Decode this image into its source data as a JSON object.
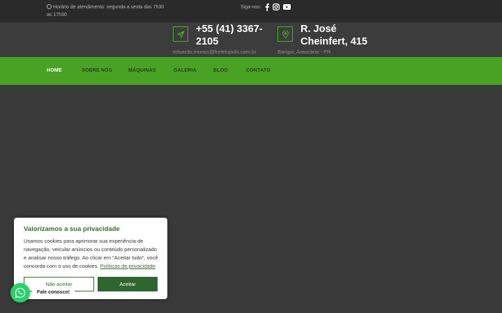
{
  "topbar": {
    "hours_text": "Horário de atendimento: segunda a sexta das 7h30 as 17h30",
    "social_label": "Siga-nos:",
    "social_icons": [
      "facebook-icon",
      "instagram-icon",
      "youtube-icon"
    ]
  },
  "header": {
    "phone": "+55 (41) 3367-2105",
    "email": "eduardo.morais@fortelupulo.com.br",
    "address": "R. José Cheinfert, 415",
    "district": "Barigui, Araucária - PR"
  },
  "nav": {
    "items": [
      {
        "label": "HOME",
        "active": true
      },
      {
        "label": "SOBRE NÓS"
      },
      {
        "label": "MÁQUINAS"
      },
      {
        "label": "GALERIA"
      },
      {
        "label": "BLOG"
      },
      {
        "label": "CONTATO"
      }
    ]
  },
  "cookie": {
    "title": "Valorizamos a sua privacidade",
    "text": "Usamos cookies para aprimorar sua experiência de navegação, veicular anúncios ou conteúdo personalizado e analisar nosso tráfego. Ao clicar em \"Aceitar tudo\", você concorda com o uso de cookies.",
    "policy_link": "Políticas de privacidade",
    "reject_label": "Não aceitar",
    "accept_label": "Aceitar"
  },
  "whatsapp": {
    "label": "Fale conosco!"
  },
  "colors": {
    "accent_green": "#4aa224",
    "dark_green": "#2f6630",
    "topbar_bg": "#2a2a2a",
    "header_bg": "#3c3c3c",
    "body_bg": "#3a3a3a"
  }
}
